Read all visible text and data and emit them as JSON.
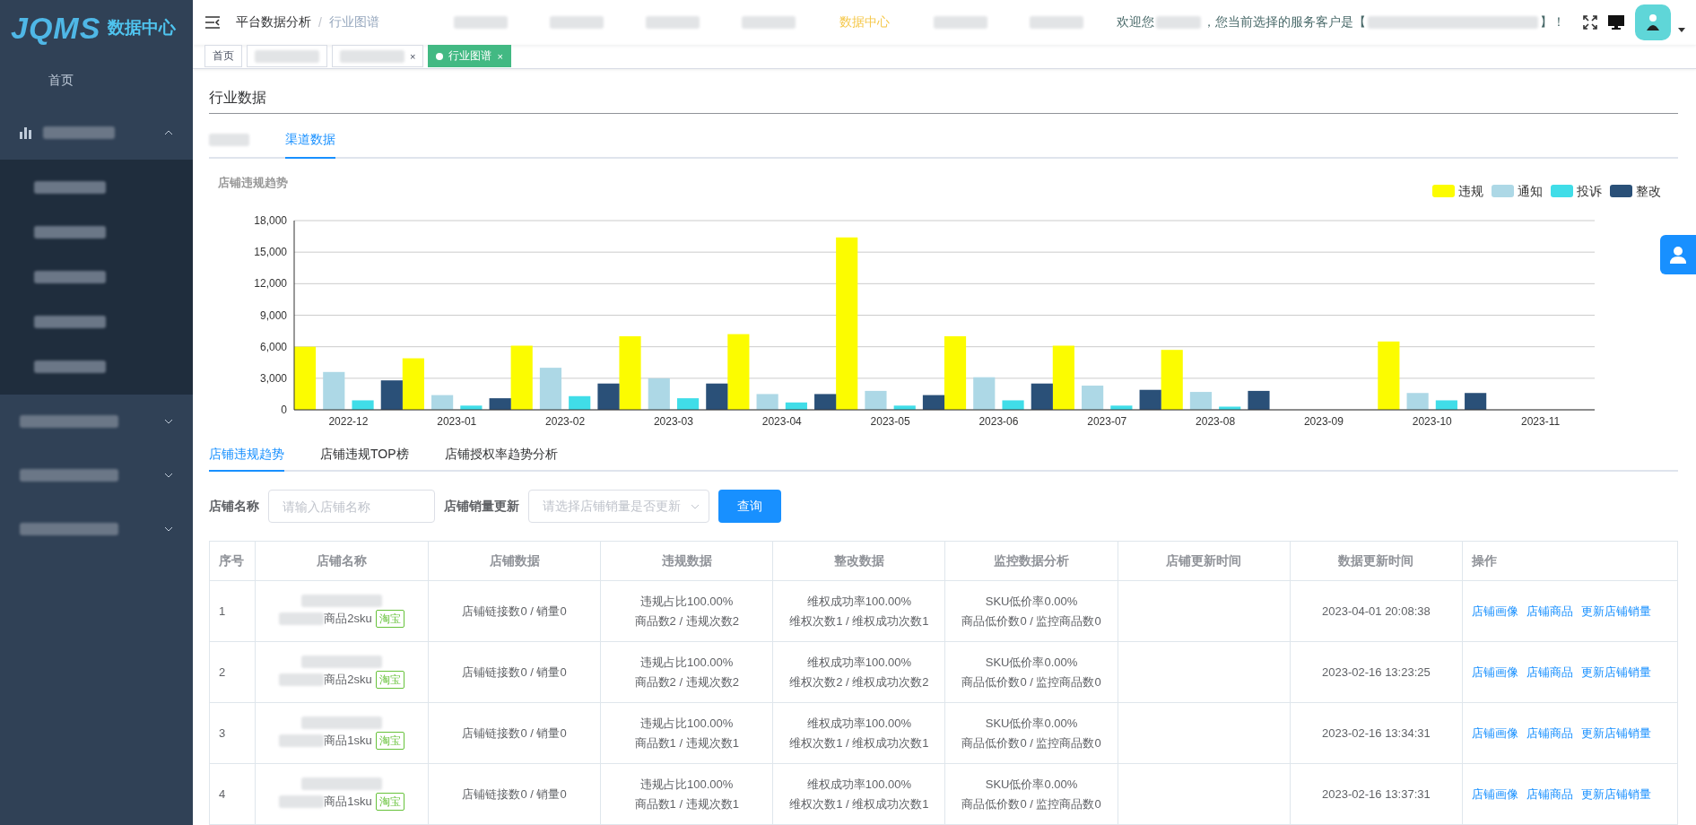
{
  "sidebar": {
    "logo": {
      "mark": "JQMS",
      "title": "数据中心"
    },
    "home": "首页",
    "groups": [
      {
        "expanded": true,
        "children": [
          {
            "selected": false
          },
          {
            "selected": false
          },
          {
            "selected": false
          },
          {
            "selected": false
          },
          {
            "selected": false
          }
        ]
      },
      {
        "expanded": false
      },
      {
        "expanded": false
      },
      {
        "expanded": false
      }
    ]
  },
  "header": {
    "breadcrumb": [
      "平台数据分析",
      "行业图谱"
    ],
    "separator": "/",
    "nav_items": [
      {
        "selected": false
      },
      {
        "selected": false
      },
      {
        "selected": false
      },
      {
        "selected": false
      },
      {
        "label": "数据中心",
        "selected": true
      },
      {
        "selected": false
      },
      {
        "selected": false
      }
    ],
    "welcome": {
      "before": "欢迎您",
      "middle": "，您当前选择的服务客户是【",
      "after": "】！"
    }
  },
  "tags": [
    {
      "label": "首页",
      "selected": false
    },
    {
      "selected": false
    },
    {
      "close": "×",
      "selected": false
    },
    {
      "label": "行业图谱",
      "close": "×",
      "selected": true
    }
  ],
  "page_title": "行业数据",
  "tabs": [
    {
      "selected": false
    },
    {
      "label": "渠道数据",
      "selected": true
    }
  ],
  "chart_data": {
    "type": "bar",
    "title": "店铺违规趋势",
    "grid": true,
    "legend": "top-right",
    "categories": [
      "2022-12",
      "2023-01",
      "2023-02",
      "2023-03",
      "2023-04",
      "2023-05",
      "2023-06",
      "2023-07",
      "2023-08",
      "2023-09",
      "2023-10",
      "2023-11"
    ],
    "ylim": [
      0,
      18000
    ],
    "yticks": [
      {
        "value": 0,
        "label": "0"
      },
      {
        "value": 3000,
        "label": "3,000"
      },
      {
        "value": 6000,
        "label": "6,000"
      },
      {
        "value": 9000,
        "label": "9,000"
      },
      {
        "value": 12000,
        "label": "12,000"
      },
      {
        "value": 15000,
        "label": "15,000"
      },
      {
        "value": 18000,
        "label": "18,000"
      }
    ],
    "series": [
      {
        "name": "违规",
        "color": "#fcfc00",
        "values": [
          6000,
          4900,
          6100,
          7000,
          7200,
          16400,
          7000,
          6100,
          5700,
          null,
          6500,
          null
        ]
      },
      {
        "name": "通知",
        "color": "#add8e6",
        "values": [
          3600,
          1400,
          4000,
          3000,
          1500,
          1800,
          3100,
          2300,
          1700,
          null,
          1600,
          null
        ]
      },
      {
        "name": "投诉",
        "color": "#40dde8",
        "values": [
          900,
          400,
          1300,
          1100,
          700,
          400,
          900,
          400,
          300,
          null,
          900,
          null
        ]
      },
      {
        "name": "整改",
        "color": "#2a5078",
        "values": [
          2800,
          1100,
          2500,
          2500,
          1500,
          1400,
          2500,
          1900,
          1800,
          null,
          1600,
          null
        ]
      }
    ]
  },
  "sub_tabs": [
    {
      "label": "店铺违规趋势",
      "selected": true
    },
    {
      "label": "店铺违规TOP榜",
      "selected": false
    },
    {
      "label": "店铺授权率趋势分析",
      "selected": false
    }
  ],
  "filters": {
    "name_label": "店铺名称",
    "name_placeholder": "请输入店铺名称",
    "sales_label": "店铺销量更新",
    "sales_placeholder": "请选择店铺销量是否更新",
    "search_button": "查询"
  },
  "table": {
    "columns": [
      "序号",
      "店铺名称",
      "店铺数据",
      "违规数据",
      "整改数据",
      "监控数据分析",
      "店铺更新时间",
      "数据更新时间",
      "操作"
    ],
    "rows": [
      {
        "index": "1",
        "sku": "商品2sku",
        "platform": "淘宝",
        "store_data": "店铺链接数0 / 销量0",
        "violation": [
          "违规占比100.00%",
          "商品数2 / 违规次数2"
        ],
        "rectify": [
          "维权成功率100.00%",
          "维权次数1 / 维权成功次数1"
        ],
        "monitor": [
          "SKU低价率0.00%",
          "商品低价数0 / 监控商品数0"
        ],
        "data_time": "2023-04-01 20:08:38",
        "actions": [
          "店铺画像",
          "店铺商品",
          "更新店铺销量"
        ]
      },
      {
        "index": "2",
        "sku": "商品2sku",
        "platform": "淘宝",
        "store_data": "店铺链接数0 / 销量0",
        "violation": [
          "违规占比100.00%",
          "商品数2 / 违规次数2"
        ],
        "rectify": [
          "维权成功率100.00%",
          "维权次数2 / 维权成功次数2"
        ],
        "monitor": [
          "SKU低价率0.00%",
          "商品低价数0 / 监控商品数0"
        ],
        "data_time": "2023-02-16 13:23:25",
        "actions": [
          "店铺画像",
          "店铺商品",
          "更新店铺销量"
        ]
      },
      {
        "index": "3",
        "sku": "商品1sku",
        "platform": "淘宝",
        "store_data": "店铺链接数0 / 销量0",
        "violation": [
          "违规占比100.00%",
          "商品数1 / 违规次数1"
        ],
        "rectify": [
          "维权成功率100.00%",
          "维权次数1 / 维权成功次数1"
        ],
        "monitor": [
          "SKU低价率0.00%",
          "商品低价数0 / 监控商品数0"
        ],
        "data_time": "2023-02-16 13:34:31",
        "actions": [
          "店铺画像",
          "店铺商品",
          "更新店铺销量"
        ]
      },
      {
        "index": "4",
        "sku": "商品1sku",
        "platform": "淘宝",
        "store_data": "店铺链接数0 / 销量0",
        "violation": [
          "违规占比100.00%",
          "商品数1 / 违规次数1"
        ],
        "rectify": [
          "维权成功率100.00%",
          "维权次数1 / 维权成功次数1"
        ],
        "monitor": [
          "SKU低价率0.00%",
          "商品低价数0 / 监控商品数0"
        ],
        "data_time": "2023-02-16 13:37:31",
        "actions": [
          "店铺画像",
          "店铺商品",
          "更新店铺销量"
        ]
      }
    ]
  }
}
